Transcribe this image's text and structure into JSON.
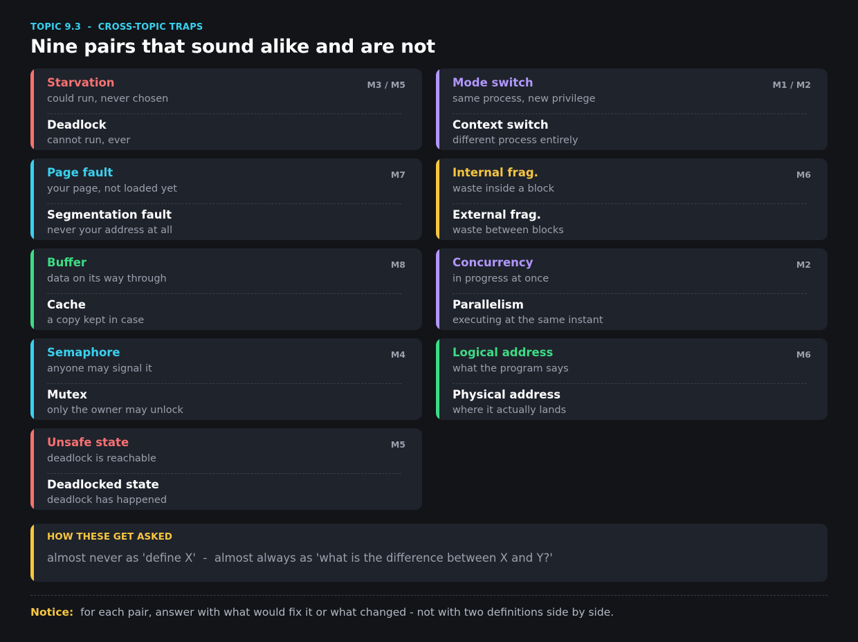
{
  "header": {
    "eyebrow": "TOPIC 9.3  -  CROSS-TOPIC TRAPS",
    "title": "Nine pairs that sound alike and are not"
  },
  "colors": {
    "red": "#f87171",
    "purple": "#b197fc",
    "cyan": "#3ad0ee",
    "yellow": "#f6c640",
    "green": "#3ddc84"
  },
  "pairs": [
    {
      "a_term": "Starvation",
      "a_desc": "could run, never chosen",
      "b_term": "Deadlock",
      "b_desc": "cannot run, ever",
      "tag": "M3 / M5",
      "color": "#f87171"
    },
    {
      "a_term": "Mode switch",
      "a_desc": "same process, new privilege",
      "b_term": "Context switch",
      "b_desc": "different process entirely",
      "tag": "M1 / M2",
      "color": "#b197fc"
    },
    {
      "a_term": "Page fault",
      "a_desc": "your page, not loaded yet",
      "b_term": "Segmentation fault",
      "b_desc": "never your address at all",
      "tag": "M7",
      "color": "#3ad0ee"
    },
    {
      "a_term": "Internal frag.",
      "a_desc": "waste inside a block",
      "b_term": "External frag.",
      "b_desc": "waste between blocks",
      "tag": "M6",
      "color": "#f6c640"
    },
    {
      "a_term": "Buffer",
      "a_desc": "data on its way through",
      "b_term": "Cache",
      "b_desc": "a copy kept in case",
      "tag": "M8",
      "color": "#3ddc84"
    },
    {
      "a_term": "Concurrency",
      "a_desc": "in progress at once",
      "b_term": "Parallelism",
      "b_desc": "executing at the same instant",
      "tag": "M2",
      "color": "#b197fc"
    },
    {
      "a_term": "Semaphore",
      "a_desc": "anyone may signal it",
      "b_term": "Mutex",
      "b_desc": "only the owner may unlock",
      "tag": "M4",
      "color": "#3ad0ee"
    },
    {
      "a_term": "Logical address",
      "a_desc": "what the program says",
      "b_term": "Physical address",
      "b_desc": "where it actually lands",
      "tag": "M6",
      "color": "#3ddc84"
    },
    {
      "a_term": "Unsafe state",
      "a_desc": "deadlock is reachable",
      "b_term": "Deadlocked state",
      "b_desc": "deadlock has happened",
      "tag": "M5",
      "color": "#f87171"
    }
  ],
  "callout": {
    "heading": "HOW THESE GET ASKED",
    "body": "almost never as 'define X'  -  almost always as 'what is the difference between X and Y?'"
  },
  "notice": {
    "label": "Notice:",
    "text": "  for each pair, answer with what would fix it or what changed - not with two definitions side by side."
  }
}
